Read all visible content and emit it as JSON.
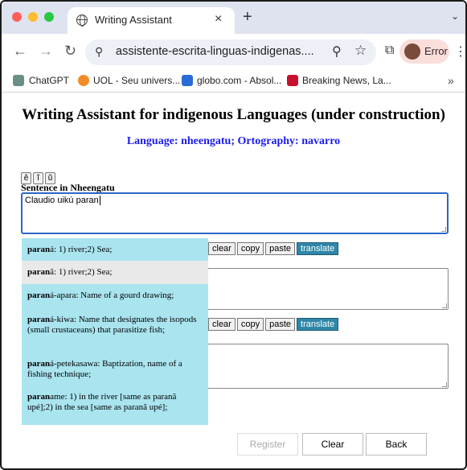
{
  "browser": {
    "tab_title": "Writing Assistant",
    "tab_close": "×",
    "new_tab": "+",
    "tab_menu": "⌄",
    "url": "assistente-escrita-linguas-indigenas....",
    "profile_label": "Error",
    "bookmarks": [
      {
        "label": "ChatGPT",
        "color": "#6b8f86"
      },
      {
        "label": "UOL - Seu univers...",
        "color": "#f28c28"
      },
      {
        "label": "globo.com - Absol...",
        "color": "#2a6ad6"
      },
      {
        "label": "Breaking News, La...",
        "color": "#c8102e"
      }
    ],
    "bookmarks_more": "»"
  },
  "page": {
    "title": "Writing Assistant for indigenous Languages (under construction)",
    "subtitle": "Language: nheengatu; Ortography: navarro",
    "char_buttons": [
      "ê",
      "ĩ",
      "ũ"
    ],
    "sentence_label": "Sentence in Nheengatu",
    "sentence_value": "Claudio uikú paran",
    "row_buttons": {
      "clear": "clear",
      "copy": "copy",
      "paste": "paste",
      "translate": "translate"
    },
    "suggestions": [
      {
        "bold": "paran",
        "rest": "á: 1) river;2) Sea;"
      },
      {
        "bold": "paran",
        "rest": "ã: 1) river;2) Sea;"
      },
      {
        "bold": "paran",
        "rest": "á-apara: Name of a gourd drawing;"
      },
      {
        "bold": "paran",
        "rest": "á-kiwa: Name that designates the isopods (small crustaceans) that parasitize fish;"
      },
      {
        "bold": "paran",
        "rest": "á-petekasawa: Baptization, name of a fishing technique;"
      },
      {
        "bold": "paran",
        "rest": "ame: 1) in the river [same as paranã upé];2) in the sea [same as paranã upé];"
      }
    ],
    "footer_buttons": {
      "register": "Register",
      "clear": "Clear",
      "back": "Back"
    }
  }
}
